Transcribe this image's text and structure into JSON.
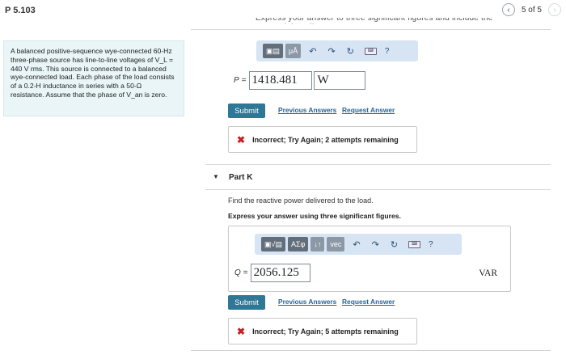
{
  "header": {
    "problem_id": "P 5.103",
    "page_count": "5 of 5",
    "prev_icon": "chevron-left-icon",
    "next_icon": "chevron-right-icon"
  },
  "cut_off_text": "Express your answer to three significant figures and include the appropriate units.",
  "problem_statement": "A balanced positive-sequence wye-connected 60-Hz three-phase source has line-to-line voltages of V_L = 440 V rms. This source is connected to a balanced wye-connected load. Each phase of the load consists of a 0.2-H inductance in series with a 50-Ω resistance. Assume that the phase of V_an is zero.",
  "part_j": {
    "toolbar": {
      "template_icon": "template-icon",
      "units_label": "μÅ",
      "undo_icon": "undo-icon",
      "redo_icon": "redo-icon",
      "reset_icon": "reset-icon",
      "keyboard_icon": "keyboard-icon",
      "help_label": "?"
    },
    "variable": "P",
    "equals": "=",
    "value": "1418.481",
    "unit": "W",
    "submit_label": "Submit",
    "previous_answers_label": "Previous Answers",
    "request_answer_label": "Request Answer",
    "feedback_text": "Incorrect; Try Again; 2 attempts remaining"
  },
  "part_k": {
    "caret_icon": "caret-down-icon",
    "title": "Part K",
    "question": "Find the reactive power delivered to the load.",
    "instruction": "Express your answer using three significant figures.",
    "toolbar": {
      "template_icon": "template-icon",
      "greek_label": "ΑΣφ",
      "sort_label": "↓↑",
      "vec_label": "vec",
      "undo_icon": "undo-icon",
      "redo_icon": "redo-icon",
      "reset_icon": "reset-icon",
      "keyboard_icon": "keyboard-icon",
      "help_label": "?"
    },
    "variable": "Q",
    "equals": "=",
    "value": "2056.125",
    "unit": "VAR",
    "submit_label": "Submit",
    "previous_answers_label": "Previous Answers",
    "request_answer_label": "Request Answer",
    "feedback_text": "Incorrect; Try Again; 5 attempts remaining"
  },
  "colors": {
    "submit": "#2e7797",
    "link": "#2a6496",
    "error_icon": "#c81e1e",
    "sidebar_bg": "#e9f5f6",
    "toolbar_bg": "#d6e4f4"
  }
}
